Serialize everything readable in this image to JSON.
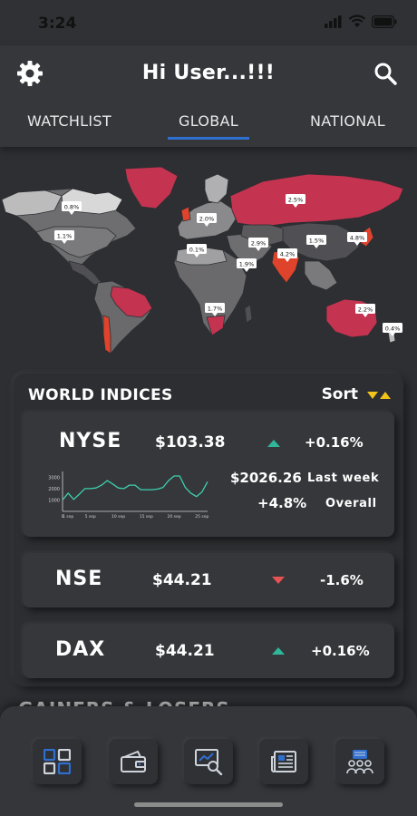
{
  "status": {
    "time": "3:24"
  },
  "header": {
    "title": "Hi User...!!!"
  },
  "tabs": [
    {
      "label": "WATCHLIST"
    },
    {
      "label": "GLOBAL"
    },
    {
      "label": "NATIONAL"
    }
  ],
  "map": {
    "labels": [
      "0.8%",
      "1.1%",
      "2.0%",
      "2.5%",
      "0.1%",
      "2.9%",
      "1.5%",
      "4.8%",
      "4.2%",
      "1.9%",
      "1.7%",
      "2.2%",
      "0.4%"
    ]
  },
  "indices": {
    "title": "WORLD INDICES",
    "sort_label": "Sort",
    "items": [
      {
        "name": "NYSE",
        "price": "$103.38",
        "change": "+0.16%",
        "direction": "up"
      },
      {
        "name": "NSE",
        "price": "$44.21",
        "change": "-1.6%",
        "direction": "down"
      },
      {
        "name": "DAX",
        "price": "$44.21",
        "change": "+0.16%",
        "direction": "up"
      }
    ],
    "nyse_detail": {
      "week_value": "$2026.26",
      "week_label": "Last week",
      "overall_value": "+4.8%",
      "overall_label": "Overall"
    }
  },
  "chart_data": {
    "type": "line",
    "x_tick_labels": [
      "0",
      "1 sep",
      "5 sep",
      "10 sep",
      "15 sep",
      "20 sep",
      "25 sep"
    ],
    "y_tick_labels": [
      "1000",
      "2000",
      "3000"
    ],
    "ylim": [
      0,
      3500
    ],
    "x": [
      0,
      1,
      2,
      3,
      4,
      5,
      6,
      7,
      8,
      9,
      10,
      11,
      12,
      13,
      14,
      15,
      16,
      17,
      18,
      19,
      20,
      21,
      22,
      23,
      24,
      25,
      26
    ],
    "values": [
      1000,
      1600,
      1050,
      1500,
      2000,
      2000,
      2050,
      2300,
      2700,
      2400,
      2050,
      2000,
      2300,
      2300,
      1900,
      1900,
      1900,
      1950,
      2100,
      2700,
      3100,
      3100,
      2100,
      1600,
      1300,
      1700,
      2600
    ],
    "color": "#3dd1b0"
  },
  "section_partial": {
    "label": "GAINERS & LOSERS"
  },
  "colors": {
    "accent": "#2f6fd0",
    "up": "#2fb79a",
    "down": "#e55353",
    "sort": "#f2c318"
  }
}
